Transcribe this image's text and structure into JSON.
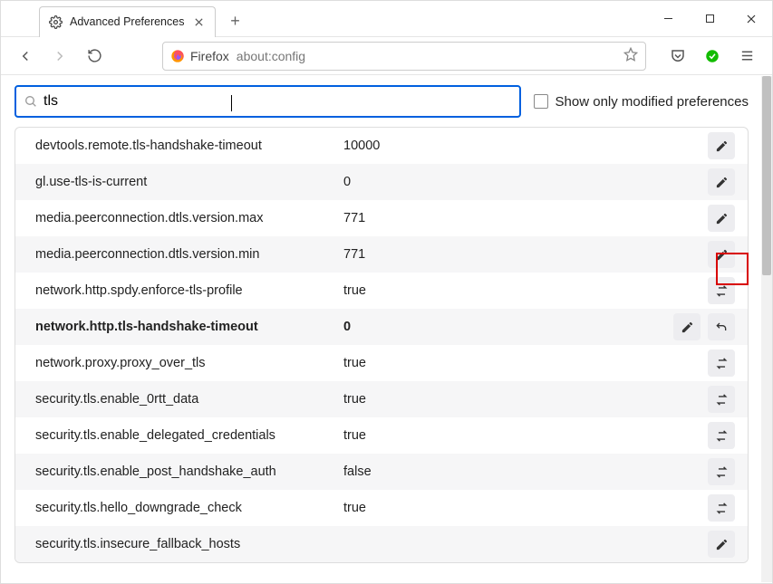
{
  "tab": {
    "title": "Advanced Preferences"
  },
  "url": {
    "identity": "Firefox",
    "path": "about:config"
  },
  "search": {
    "value": "tls"
  },
  "show_only_modified": {
    "label": "Show only modified preferences",
    "checked": false
  },
  "prefs": [
    {
      "name": "devtools.remote.tls-handshake-timeout",
      "value": "10000",
      "type": "number",
      "modified": false,
      "highlight": false
    },
    {
      "name": "gl.use-tls-is-current",
      "value": "0",
      "type": "number",
      "modified": false,
      "highlight": false
    },
    {
      "name": "media.peerconnection.dtls.version.max",
      "value": "771",
      "type": "number",
      "modified": false,
      "highlight": false
    },
    {
      "name": "media.peerconnection.dtls.version.min",
      "value": "771",
      "type": "number",
      "modified": false,
      "highlight": false
    },
    {
      "name": "network.http.spdy.enforce-tls-profile",
      "value": "true",
      "type": "boolean",
      "modified": false,
      "highlight": false
    },
    {
      "name": "network.http.tls-handshake-timeout",
      "value": "0",
      "type": "number",
      "modified": true,
      "highlight": true
    },
    {
      "name": "network.proxy.proxy_over_tls",
      "value": "true",
      "type": "boolean",
      "modified": false,
      "highlight": false
    },
    {
      "name": "security.tls.enable_0rtt_data",
      "value": "true",
      "type": "boolean",
      "modified": false,
      "highlight": false
    },
    {
      "name": "security.tls.enable_delegated_credentials",
      "value": "true",
      "type": "boolean",
      "modified": false,
      "highlight": false
    },
    {
      "name": "security.tls.enable_post_handshake_auth",
      "value": "false",
      "type": "boolean",
      "modified": false,
      "highlight": false
    },
    {
      "name": "security.tls.hello_downgrade_check",
      "value": "true",
      "type": "boolean",
      "modified": false,
      "highlight": false
    },
    {
      "name": "security.tls.insecure_fallback_hosts",
      "value": "",
      "type": "string",
      "modified": false,
      "highlight": false
    }
  ]
}
